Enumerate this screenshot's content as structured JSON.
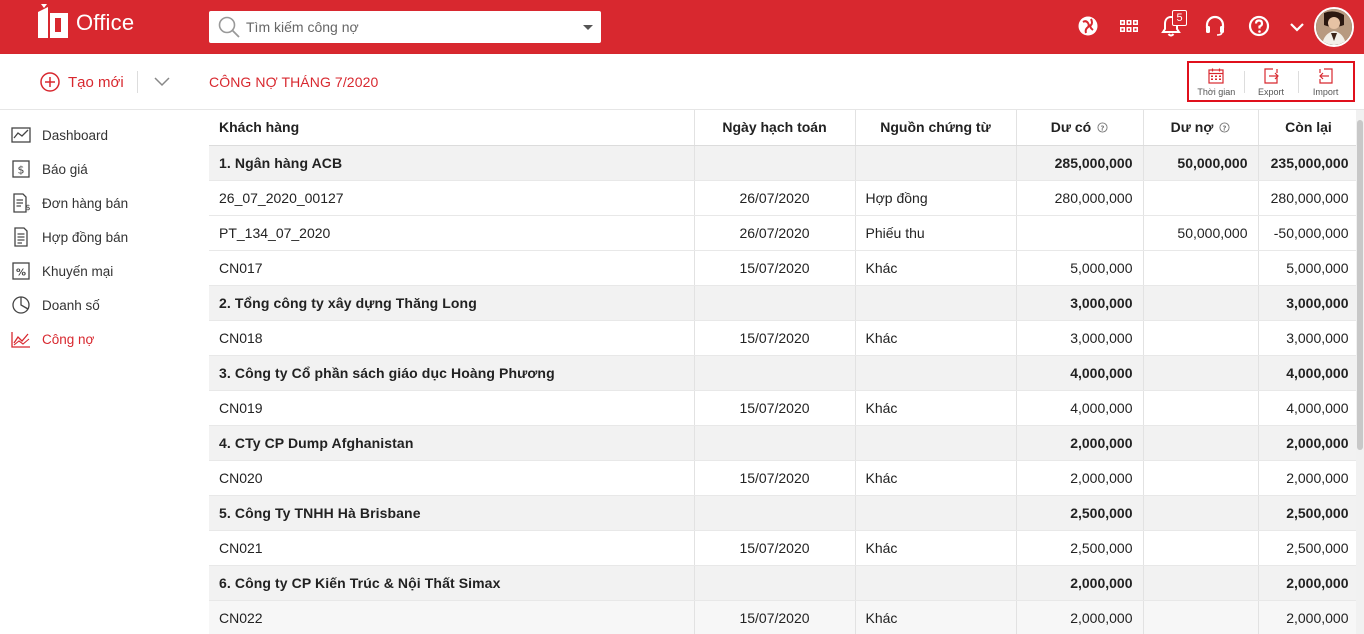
{
  "app": {
    "logo_text": "Office"
  },
  "search": {
    "placeholder": "Tìm kiếm công nợ"
  },
  "header": {
    "notification_count": "5"
  },
  "toolbar": {
    "create_label": "Tạo mới",
    "page_title": "CÔNG NỢ THÁNG 7/2020",
    "tools": [
      {
        "label": "Thời gian",
        "icon": "calendar-icon"
      },
      {
        "label": "Export",
        "icon": "export-icon"
      },
      {
        "label": "Import",
        "icon": "import-icon"
      }
    ]
  },
  "sidebar": {
    "items": [
      {
        "label": "Dashboard",
        "icon": "chart-line-icon"
      },
      {
        "label": "Báo giá",
        "icon": "dollar-doc-icon"
      },
      {
        "label": "Đơn hàng bán",
        "icon": "order-list-icon"
      },
      {
        "label": "Hợp đồng bán",
        "icon": "contract-icon"
      },
      {
        "label": "Khuyến mại",
        "icon": "percent-icon"
      },
      {
        "label": "Doanh số",
        "icon": "pie-chart-icon"
      },
      {
        "label": "Công nợ",
        "icon": "debt-chart-icon",
        "active": true
      }
    ]
  },
  "table": {
    "columns": [
      "Khách hàng",
      "Ngày hạch toán",
      "Nguồn chứng từ",
      "Dư có",
      "Dư nợ",
      "Còn lại"
    ],
    "rows": [
      {
        "type": "group",
        "cells": [
          "1. Ngân hàng ACB",
          "",
          "",
          "285,000,000",
          "50,000,000",
          "235,000,000"
        ]
      },
      {
        "type": "item",
        "cells": [
          "26_07_2020_00127",
          "26/07/2020",
          "Hợp đồng",
          "280,000,000",
          "",
          "280,000,000"
        ]
      },
      {
        "type": "item",
        "cells": [
          "PT_134_07_2020",
          "26/07/2020",
          "Phiếu thu",
          "",
          "50,000,000",
          "-50,000,000"
        ]
      },
      {
        "type": "item",
        "cells": [
          "CN017",
          "15/07/2020",
          "Khác",
          "5,000,000",
          "",
          "5,000,000"
        ]
      },
      {
        "type": "group",
        "cells": [
          "2. Tổng công ty xây dựng Thăng Long",
          "",
          "",
          "3,000,000",
          "",
          "3,000,000"
        ]
      },
      {
        "type": "item",
        "cells": [
          "CN018",
          "15/07/2020",
          "Khác",
          "3,000,000",
          "",
          "3,000,000"
        ]
      },
      {
        "type": "group",
        "cells": [
          "3. Công ty Cổ phần sách giáo dục Hoàng Phương",
          "",
          "",
          "4,000,000",
          "",
          "4,000,000"
        ]
      },
      {
        "type": "item",
        "cells": [
          "CN019",
          "15/07/2020",
          "Khác",
          "4,000,000",
          "",
          "4,000,000"
        ]
      },
      {
        "type": "group",
        "cells": [
          "4. CTy CP Dump Afghanistan",
          "",
          "",
          "2,000,000",
          "",
          "2,000,000"
        ]
      },
      {
        "type": "item",
        "cells": [
          "CN020",
          "15/07/2020",
          "Khác",
          "2,000,000",
          "",
          "2,000,000"
        ]
      },
      {
        "type": "group",
        "cells": [
          "5. Công Ty TNHH Hà Brisbane",
          "",
          "",
          "2,500,000",
          "",
          "2,500,000"
        ]
      },
      {
        "type": "item",
        "cells": [
          "CN021",
          "15/07/2020",
          "Khác",
          "2,500,000",
          "",
          "2,500,000"
        ]
      },
      {
        "type": "group",
        "cells": [
          "6. Công ty CP Kiến Trúc & Nội Thất Simax",
          "",
          "",
          "2,000,000",
          "",
          "2,000,000"
        ]
      },
      {
        "type": "item",
        "cells": [
          "CN022",
          "15/07/2020",
          "Khác",
          "2,000,000",
          "",
          "2,000,000"
        ]
      }
    ]
  },
  "colors": {
    "brand": "#d8282f",
    "group_row_bg": "#f2f2f2"
  }
}
